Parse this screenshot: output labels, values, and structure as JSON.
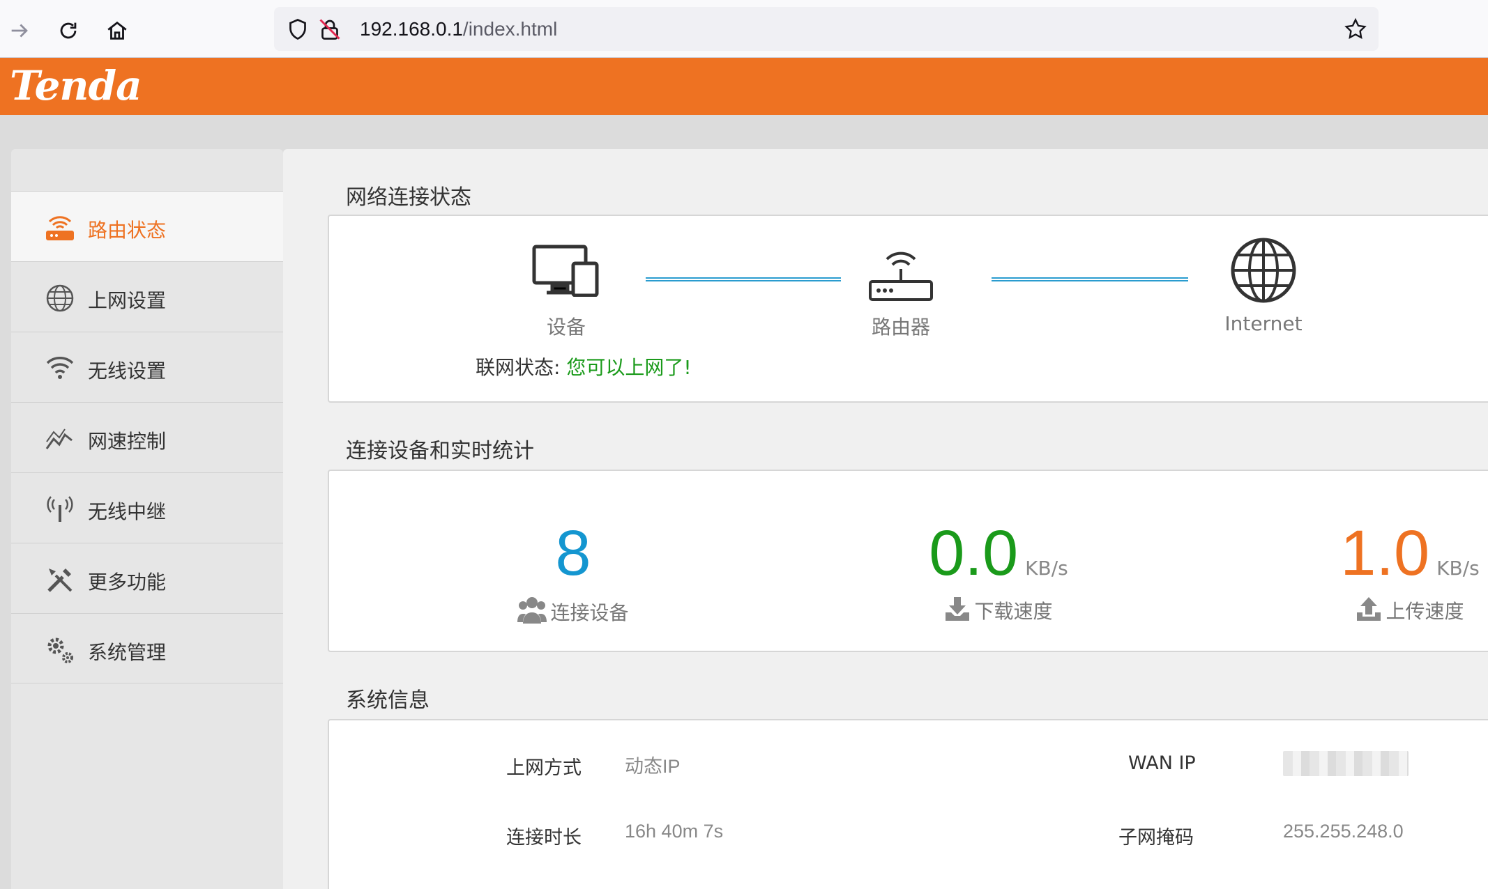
{
  "browser": {
    "url_host": "192.168.0.1",
    "url_path": "/index.html"
  },
  "brand": {
    "logo_text": "Tenda",
    "color": "#ee7222"
  },
  "sidebar": {
    "items": [
      {
        "label": "路由状态",
        "icon": "router-status-icon",
        "active": true
      },
      {
        "label": "上网设置",
        "icon": "globe-icon"
      },
      {
        "label": "无线设置",
        "icon": "wifi-icon"
      },
      {
        "label": "网速控制",
        "icon": "speed-chart-icon"
      },
      {
        "label": "无线中继",
        "icon": "antenna-icon"
      },
      {
        "label": "更多功能",
        "icon": "tools-icon"
      },
      {
        "label": "系统管理",
        "icon": "gears-icon"
      }
    ]
  },
  "network": {
    "title": "网络连接状态",
    "device_label": "设备",
    "router_label": "路由器",
    "internet_label": "Internet",
    "status_label": "联网状态:",
    "status_value": "您可以上网了!"
  },
  "stats": {
    "title": "连接设备和实时统计",
    "devices_count": "8",
    "devices_label": "连接设备",
    "download_value": "0.0",
    "download_unit": "KB/s",
    "download_label": "下载速度",
    "upload_value": "1.0",
    "upload_unit": "KB/s",
    "upload_label": "上传速度"
  },
  "sysinfo": {
    "title": "系统信息",
    "conn_type_label": "上网方式",
    "conn_type_value": "动态IP",
    "wan_ip_label": "WAN IP",
    "uptime_label": "连接时长",
    "uptime_value": "16h 40m 7s",
    "subnet_label": "子网掩码",
    "subnet_value": "255.255.248.0"
  },
  "colors": {
    "blue": "#1496d0",
    "green": "#1a9a1a",
    "orange": "#ee7222"
  }
}
